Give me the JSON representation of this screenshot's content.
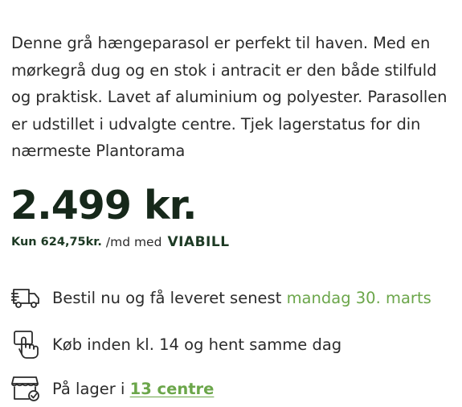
{
  "product": {
    "description": "Denne grå hængeparasol er perfekt til haven. Med en mørkegrå dug og en stok i antracit er den både stilfuld og praktisk. Lavet af aluminium og polyester. Parasollen er udstillet i udvalgte centre. Tjek lagerstatus for din nærmeste Plantorama",
    "price": "2.499 kr."
  },
  "financing": {
    "amount": "Kun 624,75kr.",
    "suffix": "/md med",
    "provider": "VIABILL"
  },
  "info": {
    "delivery_text": "Bestil nu og få leveret senest",
    "delivery_date": "mandag 30. marts",
    "pickup_text": "Køb inden kl. 14 og hent samme dag",
    "stock_text": "På lager i",
    "stock_link": "13 centre"
  },
  "icons": {
    "delivery": "delivery-truck-icon",
    "pickup": "hand-click-icon",
    "stock": "store-check-icon"
  },
  "colors": {
    "accent_green": "#6ba64a",
    "dark_green": "#16281a"
  }
}
